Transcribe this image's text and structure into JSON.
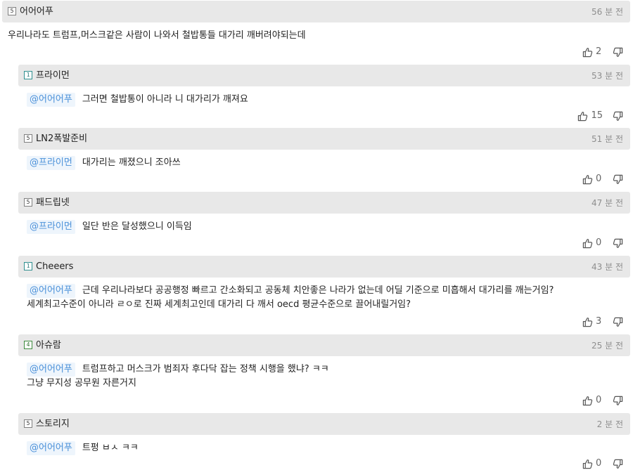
{
  "comments": [
    {
      "nick": "어어어푸",
      "level": "5",
      "time": "56 분 전",
      "mention": "",
      "lines": [
        "우리나라도 트럼프,머스크같은 사람이 나와서 철밥통들 대가리 깨버려야되는데"
      ],
      "likes": "2"
    },
    {
      "nick": "프라이먼",
      "level": "1",
      "time": "53 분 전",
      "mention": "@어어어푸",
      "lines": [
        "그러면 철밥통이 아니라 니 대가리가 깨져요"
      ],
      "likes": "15"
    },
    {
      "nick": "LN2폭발준비",
      "level": "5",
      "time": "51 분 전",
      "mention": "@프라이먼",
      "lines": [
        "대가리는 깨졌으니 조아쓰"
      ],
      "likes": "0"
    },
    {
      "nick": "패드립넷",
      "level": "5",
      "time": "47 분 전",
      "mention": "@프라이먼",
      "lines": [
        "일단 반은 달성했으니 이득임"
      ],
      "likes": "0"
    },
    {
      "nick": "Cheeers",
      "level": "1",
      "time": "43 분 전",
      "mention": "@어어어푸",
      "lines": [
        "근데 우리나라보다 공공행정 빠르고 간소화되고 공동체 치안좋은 나라가 없는데 어딜 기준으로 미흡해서 대가리를 깨는거임?",
        "세계최고수준이 아니라 ㄹㅇ로 진짜 세계최고인데 대가리 다 깨서 oecd 평균수준으로 끌어내릴거임?"
      ],
      "likes": "3"
    },
    {
      "nick": "아슈람",
      "level": "4",
      "time": "25 분 전",
      "mention": "@어어어푸",
      "lines": [
        "트럼프하고 머스크가 범죄자 후다닥 잡는 정책 시행을 했냐? ㅋㅋ",
        "그냥 무지성 공무원 자른거지"
      ],
      "likes": "0"
    },
    {
      "nick": "스토리지",
      "level": "5",
      "time": "2 분 전",
      "mention": "@어어어푸",
      "lines": [
        "트펑 ㅂㅅ ㅋㅋ"
      ],
      "likes": "0"
    }
  ]
}
